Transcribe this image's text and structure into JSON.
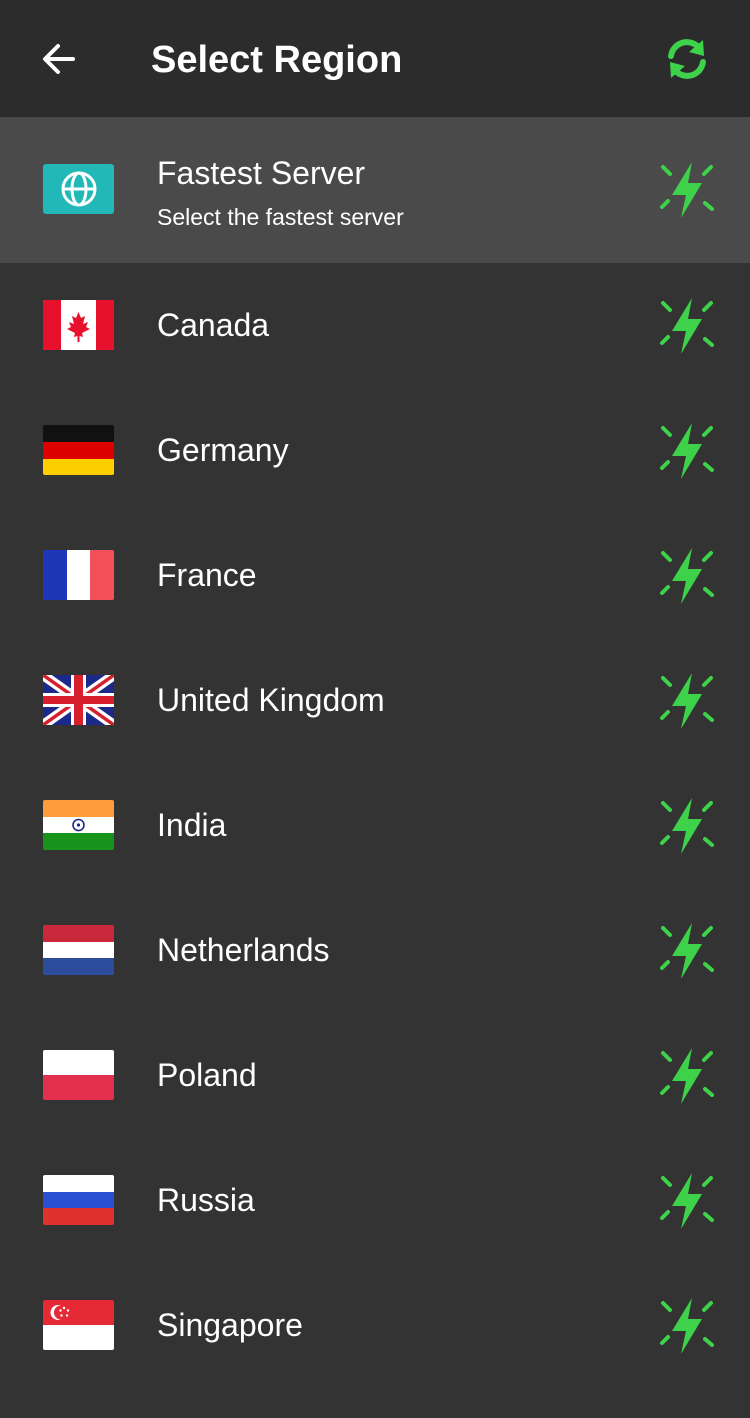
{
  "header": {
    "title": "Select Region",
    "back_icon": "arrow-left-icon",
    "refresh_icon": "refresh-icon"
  },
  "fastest": {
    "name": "Fastest Server",
    "subtitle": "Select the fastest server",
    "icon": "globe-icon"
  },
  "regions": [
    {
      "name": "Canada",
      "flag": "canada-flag-icon"
    },
    {
      "name": "Germany",
      "flag": "germany-flag-icon"
    },
    {
      "name": "France",
      "flag": "france-flag-icon"
    },
    {
      "name": "United Kingdom",
      "flag": "uk-flag-icon"
    },
    {
      "name": "India",
      "flag": "india-flag-icon"
    },
    {
      "name": "Netherlands",
      "flag": "netherlands-flag-icon"
    },
    {
      "name": "Poland",
      "flag": "poland-flag-icon"
    },
    {
      "name": "Russia",
      "flag": "russia-flag-icon"
    },
    {
      "name": "Singapore",
      "flag": "singapore-flag-icon"
    }
  ],
  "colors": {
    "background": "#333333",
    "header": "#2c2c2c",
    "selected_row": "#4a4a4a",
    "accent_green": "#3ed24a",
    "globe_box": "#23b8b8"
  }
}
